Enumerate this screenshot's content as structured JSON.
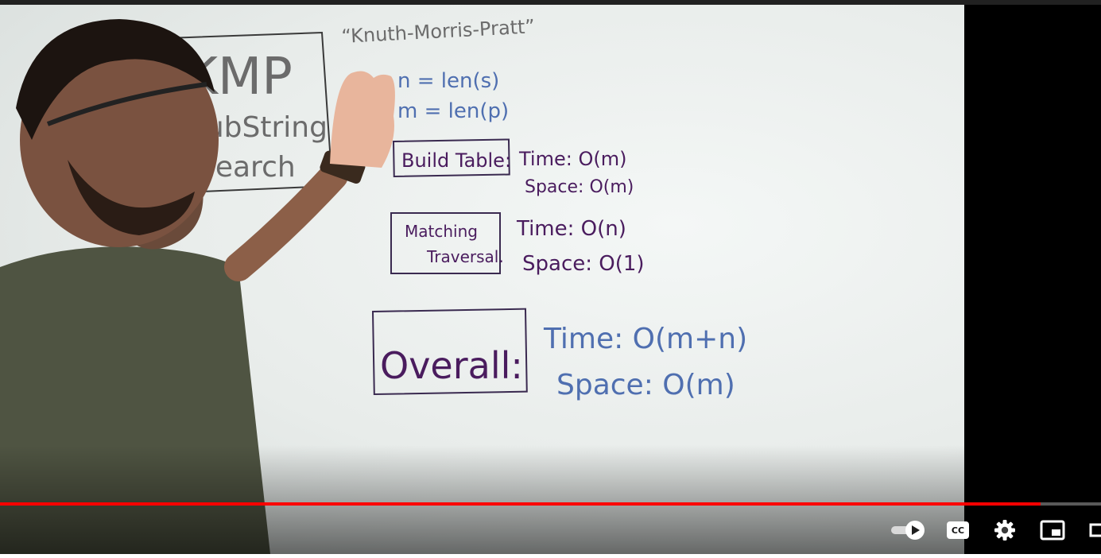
{
  "whiteboard": {
    "title_quote": "“Knuth-Morris-Pratt”",
    "title_box": [
      "KMP",
      "SubString",
      "Search"
    ],
    "vars": [
      "n = len(s)",
      "m = len(p)"
    ],
    "build_table": {
      "label": "Build Table:",
      "time": "Time: O(m)",
      "space": "Space: O(m)"
    },
    "matching": {
      "label_line1": "Matching",
      "label_line2": "Traversal.",
      "time": "Time: O(n)",
      "space": "Space: O(1)"
    },
    "overall": {
      "label": "Overall:",
      "time": "Time: O(m+n)",
      "space": "Space: O(m)"
    }
  },
  "player": {
    "progress": 0.945,
    "accent_color": "#ff0000"
  },
  "controls": {
    "autoplay_icon": "autoplay-toggle-icon",
    "cc_label": "CC",
    "settings_icon": "gear-icon",
    "miniplayer_icon": "miniplayer-icon",
    "theater_icon": "theater-icon"
  }
}
